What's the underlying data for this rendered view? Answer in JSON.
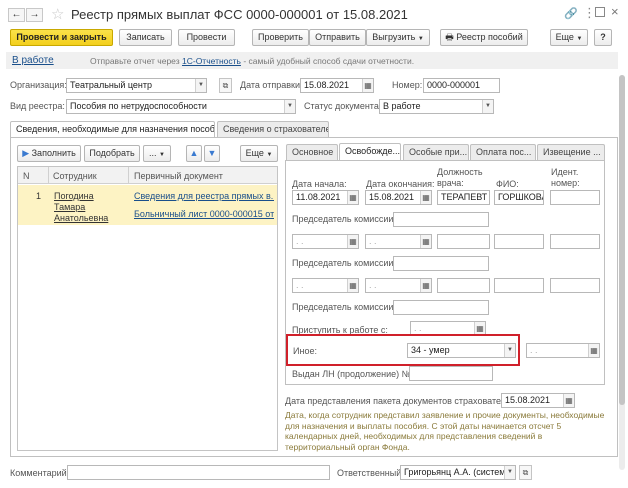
{
  "window": {
    "title": "Реестр прямых выплат ФСС 0000-000001 от 15.08.2021",
    "status_link": "В работе",
    "hint_prefix": "Отправьте отчет через",
    "hint_link": "1С-Отчетность",
    "hint_suffix": "- самый удобный способ сдачи отчетности."
  },
  "toolbar": {
    "post_close": "Провести и закрыть",
    "save": "Записать",
    "post": "Провести",
    "check": "Проверить",
    "send": "Отправить",
    "export": "Выгрузить",
    "benefit_registry": "Реестр пособий",
    "more": "Еще",
    "help": "?"
  },
  "header": {
    "org_label": "Организация:",
    "org_value": "Театральный центр",
    "send_date_label": "Дата отправки:",
    "send_date_value": "15.08.2021",
    "number_label": "Номер:",
    "number_value": "0000-000001",
    "registry_type_label": "Вид реестра:",
    "registry_type_value": "Пособия по нетрудоспособности",
    "doc_status_label": "Статус документа:",
    "doc_status_value": "В работе"
  },
  "main_tabs": [
    "Сведения, необходимые для назначения пособия",
    "Сведения о страхователе"
  ],
  "left": {
    "fill": "Заполнить",
    "pick": "Подобрать",
    "dots": "...",
    "more": "Еще",
    "columns": [
      "N",
      "Сотрудник",
      "Первичный документ"
    ],
    "row": {
      "n": "1",
      "employee": "Погодина Тамара Анатольевна",
      "doc1": "Сведения для реестра прямых в...",
      "doc2": "Больничный лист 0000-000015 от..."
    }
  },
  "right_tabs": [
    "Основное",
    "Освобожде...",
    "Особые при...",
    "Оплата пос...",
    "Извещение ..."
  ],
  "release": {
    "col_start": "Дата начала:",
    "col_end": "Дата окончания:",
    "col_position": "Должность врача:",
    "col_fio": "ФИО:",
    "col_id": "Идент. номер:",
    "r1_start": "11.08.2021",
    "r1_end": "15.08.2021",
    "r1_position": "ТЕРАПЕВТ",
    "r1_fio": "ГОРШКОВА",
    "chair_label": "Председатель комиссии:",
    "empty_date": " .  .",
    "return_label": "Приступить к работе с:",
    "other_label": "Иное:",
    "other_value": "34 - умер",
    "continuation_label": "Выдан ЛН (продолжение) №:",
    "package_date_label": "Дата представления пакета документов страхователю:",
    "package_date_value": "15.08.2021",
    "note": "Дата, когда сотрудник представил заявление и прочие документы, необходимые для назначения и выплаты пособия. С этой даты начинается отсчет 5 календарных дней, необходимых для представления сведений в территориальный орган Фонда."
  },
  "footer": {
    "comment_label": "Комментарий:",
    "responsible_label": "Ответственный:",
    "responsible_value": "Григорьянц А.А. (системн"
  },
  "colors": {
    "primary_btn": "#f3cf1c",
    "highlight_border": "#d0202a",
    "selected_row": "#fdf3c4",
    "link": "#1a4f8b",
    "note_text": "#8a7a3a"
  }
}
